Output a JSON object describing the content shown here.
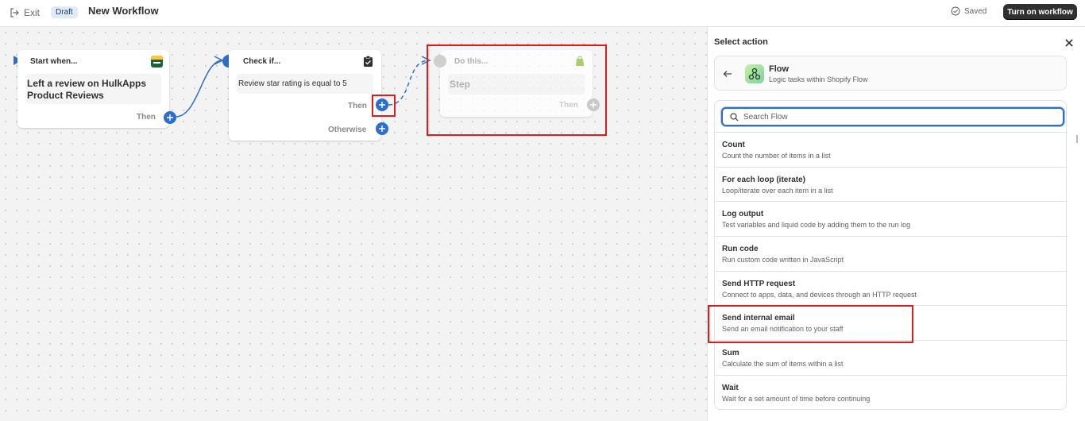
{
  "topbar": {
    "exit_label": "Exit",
    "draft_badge": "Draft",
    "title": "New Workflow",
    "saved_label": "Saved",
    "turn_on_label": "Turn on workflow"
  },
  "canvas": {
    "start_card": {
      "label": "Start when...",
      "icon": "hulkapps-icon",
      "trigger": "Left a review on HulkApps Product Reviews",
      "then_label": "Then"
    },
    "check_card": {
      "label": "Check if...",
      "icon": "clipboard-check-icon",
      "condition": "Review star rating is equal to 5",
      "then_label": "Then",
      "otherwise_label": "Otherwise"
    },
    "do_card": {
      "label": "Do this...",
      "icon": "shopify-bag-icon",
      "step": "Step",
      "then_label": "Then"
    }
  },
  "panel": {
    "title": "Select action",
    "app": {
      "name": "Flow",
      "description": "Logic tasks within Shopify Flow",
      "icon": "flow-icon"
    },
    "search_placeholder": "Search Flow",
    "actions": [
      {
        "title": "Count",
        "description": "Count the number of items in a list"
      },
      {
        "title": "For each loop (iterate)",
        "description": "Loop/iterate over each item in a list"
      },
      {
        "title": "Log output",
        "description": "Test variables and liquid code by adding them to the run log"
      },
      {
        "title": "Run code",
        "description": "Run custom code written in JavaScript"
      },
      {
        "title": "Send HTTP request",
        "description": "Connect to apps, data, and devices through an HTTP request"
      },
      {
        "title": "Send internal email",
        "description": "Send an email notification to your staff"
      },
      {
        "title": "Sum",
        "description": "Calculate the sum of items within a list"
      },
      {
        "title": "Wait",
        "description": "Wait for a set amount of time before continuing"
      }
    ]
  },
  "colors": {
    "accent": "#2c6ecb",
    "highlight": "#e01b1b",
    "primary_button": "#303030"
  }
}
